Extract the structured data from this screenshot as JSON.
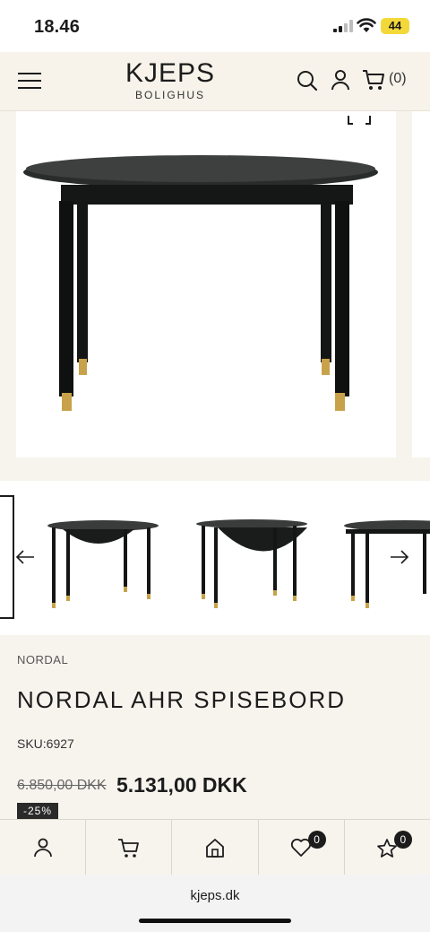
{
  "status_bar": {
    "time": "18.46",
    "battery": "44"
  },
  "header": {
    "logo_name": "KJEPS",
    "logo_sub": "BOLIGHUS",
    "cart_count": "(0)"
  },
  "product": {
    "brand": "NORDAL",
    "title": "NORDAL AHR SPISEBORD",
    "sku": "SKU:6927",
    "old_price": "6.850,00 DKK",
    "new_price": "5.131,00 DKK",
    "discount": "-25%"
  },
  "bottom_nav": {
    "wishlist_count": "0",
    "favorites_count": "0"
  },
  "browser": {
    "url": "kjeps.dk"
  },
  "colors": {
    "accent": "#1c1c1c",
    "background": "#f7f4ee",
    "battery": "#f3d83a",
    "brass": "#c8a24a"
  },
  "icons": [
    "menu-icon",
    "search-icon",
    "user-icon",
    "cart-icon",
    "expand-icon",
    "arrow-left-icon",
    "arrow-right-icon",
    "home-icon",
    "heart-icon",
    "star-icon"
  ]
}
